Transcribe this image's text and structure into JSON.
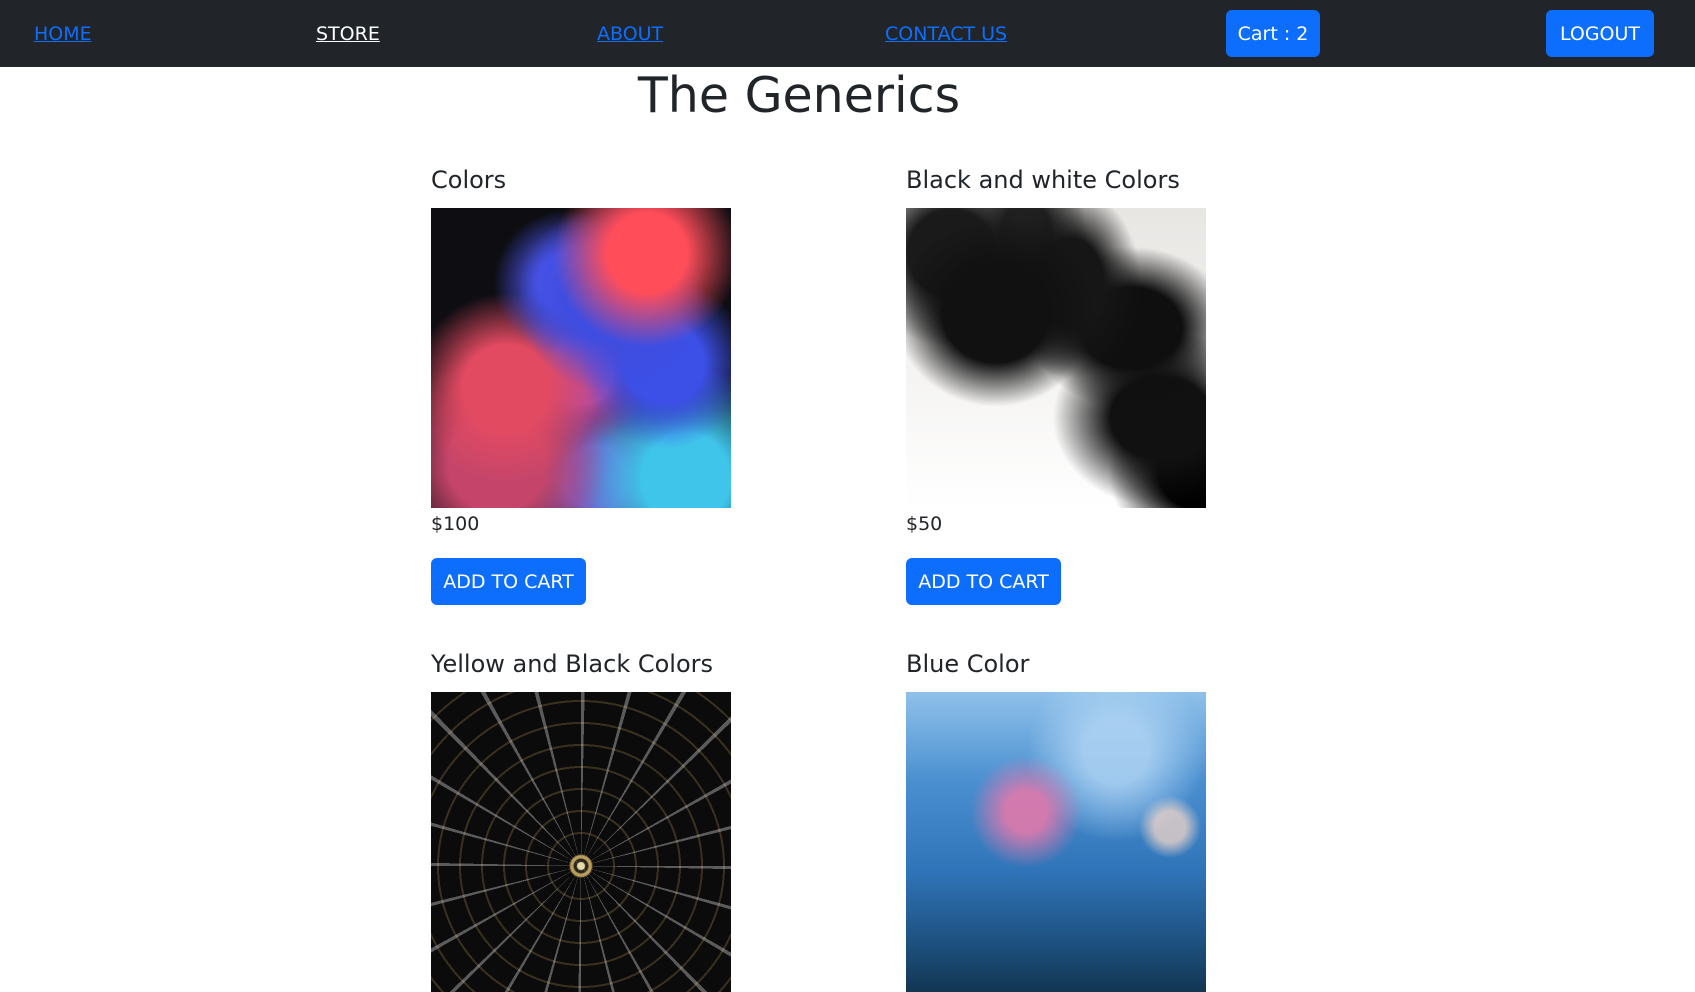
{
  "nav": {
    "home": "HOME",
    "store": "STORE",
    "about": "ABOUT",
    "contact": "CONTACT US",
    "cart": "Cart : 2",
    "logout": "LOGOUT"
  },
  "page": {
    "title": "The Generics"
  },
  "products": [
    {
      "title": "Colors",
      "price": "$100",
      "button": "ADD TO CART",
      "image_name": "colorful-smoke-image"
    },
    {
      "title": "Black and white Colors",
      "price": "$50",
      "button": "ADD TO CART",
      "image_name": "black-ink-image"
    },
    {
      "title": "Yellow and Black Colors",
      "price": "",
      "button": "",
      "image_name": "radial-tunnel-image"
    },
    {
      "title": "Blue Color",
      "price": "",
      "button": "",
      "image_name": "blue-bokeh-image"
    }
  ],
  "colors": {
    "navbar_bg": "#212529",
    "link": "#0d6efd",
    "active_link": "#ffffff",
    "button_bg": "#0d6efd",
    "button_text": "#ffffff",
    "text": "#212529"
  }
}
